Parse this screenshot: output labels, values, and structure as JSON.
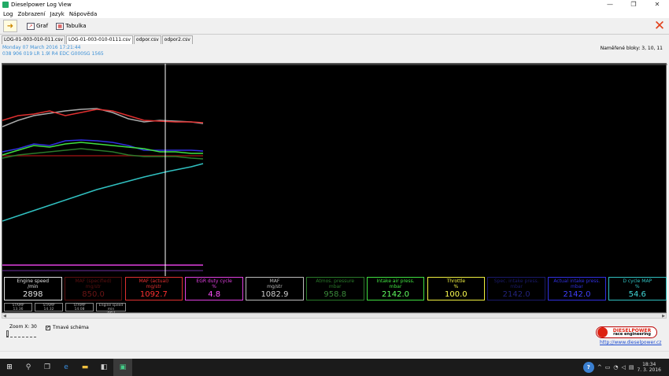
{
  "window": {
    "title": "Dieselpower Log View",
    "controls": [
      "—",
      "❐",
      "✕"
    ]
  },
  "menu": [
    "Log",
    "Zobrazení",
    "Jazyk",
    "Nápověda"
  ],
  "toolbar": {
    "graf_label": "Graf",
    "tabulka_label": "Tabulka"
  },
  "tabs": [
    {
      "label": "LOG-01-003-010-011.csv",
      "active": false
    },
    {
      "label": "LOG-01-003-010-0111.csv",
      "active": true
    },
    {
      "label": "odpor.csv",
      "active": false
    },
    {
      "label": "odpor2.csv",
      "active": false
    }
  ],
  "info": {
    "date": "Monday 07 March 2016 17:21:44",
    "ecu": "038 906 019 LR  1.9l R4 EDC G000SG  1565"
  },
  "blocks_label": "Naměřené bloky: 3, 10, 11",
  "gauges": [
    {
      "label": "Engine speed",
      "unit": "/min",
      "value": "2898",
      "color": "#e0e0e0",
      "valcolor": "#e0e0e0"
    },
    {
      "label": "MAF (specified)",
      "unit": "mg/str",
      "value": "850.0",
      "color": "#5a1010",
      "valcolor": "#6b1515"
    },
    {
      "label": "MAF (actual)",
      "unit": "mg/str",
      "value": "1092.7",
      "color": "#e03030",
      "valcolor": "#ff3030"
    },
    {
      "label": "EGR duty cycle",
      "unit": "%",
      "value": "4.8",
      "color": "#e040e0",
      "valcolor": "#ff50ff"
    },
    {
      "label": "MAF",
      "unit": "mg/str",
      "value": "1082.9",
      "color": "#bbbbbb",
      "valcolor": "#cccccc"
    },
    {
      "label": "Atmos. pressure",
      "unit": "mbar",
      "value": "958.8",
      "color": "#2a7a2a",
      "valcolor": "#3a8a3a"
    },
    {
      "label": "Intake air press.",
      "unit": "mbar",
      "value": "2142.0",
      "color": "#40e040",
      "valcolor": "#60ff60"
    },
    {
      "label": "Throttle",
      "unit": "%",
      "value": "100.0",
      "color": "#f0f040",
      "valcolor": "#ffff50"
    },
    {
      "label": "Spec. intake press.",
      "unit": "mbar",
      "value": "2142.0",
      "color": "#1a1a6a",
      "valcolor": "#22227a"
    },
    {
      "label": "Actual intake press.",
      "unit": "mbar",
      "value": "2142.0",
      "color": "#3030e0",
      "valcolor": "#4040ff"
    },
    {
      "label": "D cycle MAP",
      "unit": "%",
      "value": "54.6",
      "color": "#30c0c0",
      "valcolor": "#40d8d8"
    }
  ],
  "mini_gauges": [
    {
      "label": "STAMP",
      "value": "13.36"
    },
    {
      "label": "STAMP",
      "value": "14.32"
    },
    {
      "label": "STAMP",
      "value": "14.08"
    },
    {
      "label": "Engine speed min",
      "value": "2951"
    }
  ],
  "zoom_label": "Zoom X: 30",
  "checkbox": {
    "label": "Tmavé schéma",
    "checked": true
  },
  "logo": {
    "name": "DIESELPOWER",
    "tagline": "race engineering"
  },
  "link": "http://www.dieselpower.cz",
  "clock": {
    "time": "18:34",
    "date": "7. 3. 2016"
  },
  "colors": {
    "chart_bg": "#000000",
    "accent_close": "#e2401a",
    "info_text": "#3a8fd6"
  }
}
